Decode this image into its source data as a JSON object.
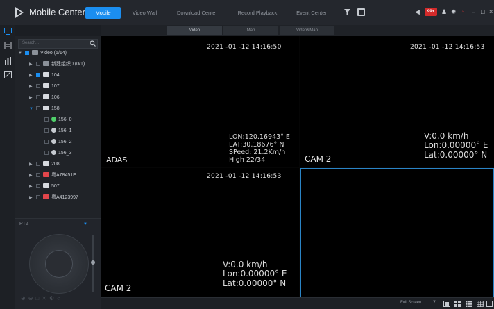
{
  "app": {
    "title": "Mobile Center"
  },
  "nav": {
    "tabs": [
      {
        "label": "Mobile",
        "active": true
      },
      {
        "label": "Video Wall",
        "active": false
      },
      {
        "label": "Download Center",
        "active": false
      },
      {
        "label": "Record Playback",
        "active": false
      },
      {
        "label": "Event Center",
        "active": false
      }
    ],
    "alarm_badge": "99+"
  },
  "view_tabs": [
    {
      "label": "Video",
      "active": true
    },
    {
      "label": "Map",
      "active": false
    },
    {
      "label": "Video&Map",
      "active": false
    }
  ],
  "search": {
    "placeholder": "Search..."
  },
  "tree": [
    {
      "label": "Video (5/14)",
      "level": 0,
      "expanded": true,
      "checked": false
    },
    {
      "label": "新建组织0 (0/1)",
      "level": 1,
      "expanded": false,
      "checked": false
    },
    {
      "label": "104",
      "level": 1,
      "expanded": false,
      "checked": true
    },
    {
      "label": "107",
      "level": 1,
      "expanded": false,
      "checked": false
    },
    {
      "label": "106",
      "level": 1,
      "expanded": false,
      "checked": false
    },
    {
      "label": "158",
      "level": 1,
      "expanded": true,
      "checked": false
    },
    {
      "label": "156_0",
      "level": 2,
      "checked": false
    },
    {
      "label": "156_1",
      "level": 2,
      "checked": false
    },
    {
      "label": "156_2",
      "level": 2,
      "checked": false
    },
    {
      "label": "156_3",
      "level": 2,
      "checked": false
    },
    {
      "label": "208",
      "level": 1,
      "expanded": false,
      "checked": false
    },
    {
      "label": "粤A78451E",
      "level": 1,
      "expanded": false,
      "checked": false
    },
    {
      "label": "507",
      "level": 1,
      "expanded": false,
      "checked": false
    },
    {
      "label": "粤A4123997",
      "level": 1,
      "expanded": false,
      "checked": false
    }
  ],
  "ptz": {
    "label": "PTZ"
  },
  "cells": {
    "c1": {
      "timestamp": "2021 -01 -12  14:16:50",
      "overlay": [
        "LON:120.16943° E",
        "LAT:30.18676° N",
        "SPeed: 21.2Km/h",
        "High 22/34"
      ],
      "camera": "ADAS"
    },
    "c2": {
      "timestamp": "2021 -01 -12  14:16:53",
      "overlay": [
        "V:0.0 km/h",
        "Lon:0.00000° E",
        "Lat:0.00000° N"
      ],
      "camera": "CAM 2"
    },
    "c3": {
      "timestamp": "2021 -01 -12  14:16:53",
      "overlay": [
        "V:0.0 km/h",
        "Lon:0.00000° E",
        "Lat:0.00000° N"
      ],
      "camera": "CAM 2"
    }
  },
  "bottom": {
    "fullscreen_label": "Full Screen"
  },
  "colors": {
    "accent": "#1b8ef0",
    "alarm": "#d32a2a",
    "selected_border": "#2a84c6"
  }
}
